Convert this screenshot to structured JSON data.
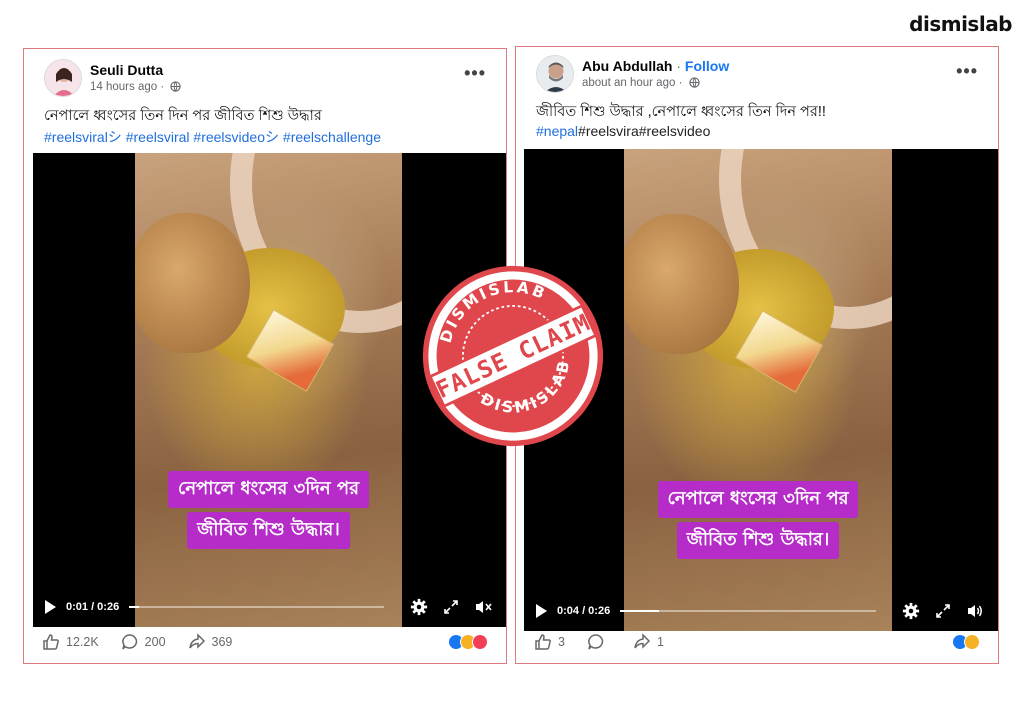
{
  "brand": {
    "logo": "dismislab"
  },
  "posts": [
    {
      "author": "Seuli Dutta",
      "follow": "",
      "time": "14 hours ago",
      "caption": "নেপালে ধ্বংসের তিন দিন পর জীবিত শিশু উদ্ধার",
      "hashtags": [
        "#reelsviralシ",
        "#reelsviral",
        "#reelsvideoシ",
        "#reelschallenge"
      ],
      "overlay_lines": [
        "নেপালে ধংসের ৩দিন পর",
        "জীবিত শিশু উদ্ধার।"
      ],
      "video_time": "0:01 / 0:26",
      "progress": 0.04,
      "likes": "12.2K",
      "comments": "200",
      "shares": "369",
      "reaction_colors": [
        "#1877f2",
        "#f7b125",
        "#f33e58"
      ]
    },
    {
      "author": "Abu Abdullah",
      "follow": "Follow",
      "time": "about an hour ago",
      "caption": "জীবিত শিশু উদ্ধার ,নেপালে ধ্বংসের তিন দিন পর!!",
      "hashtags": [
        "#nepal",
        "#reelsvira",
        "#reelsvideo"
      ],
      "overlay_lines": [
        "নেপালে ধংসের ৩দিন পর",
        "জীবিত শিশু উদ্ধার।"
      ],
      "video_time": "0:04 / 0:26",
      "progress": 0.15,
      "likes": "3",
      "comments": "",
      "shares": "1",
      "reaction_colors": [
        "#1877f2",
        "#f7b125"
      ]
    }
  ],
  "stamp": {
    "top": "DISMISLAB",
    "center": "FALSE CLAIM",
    "bottom": "DISMISLAB",
    "color": "#e0474c"
  },
  "icons": [
    "more-icon",
    "globe-icon",
    "play-icon",
    "gear-icon",
    "fullscreen-icon",
    "volume-icon",
    "like-icon",
    "comment-icon",
    "share-icon"
  ]
}
